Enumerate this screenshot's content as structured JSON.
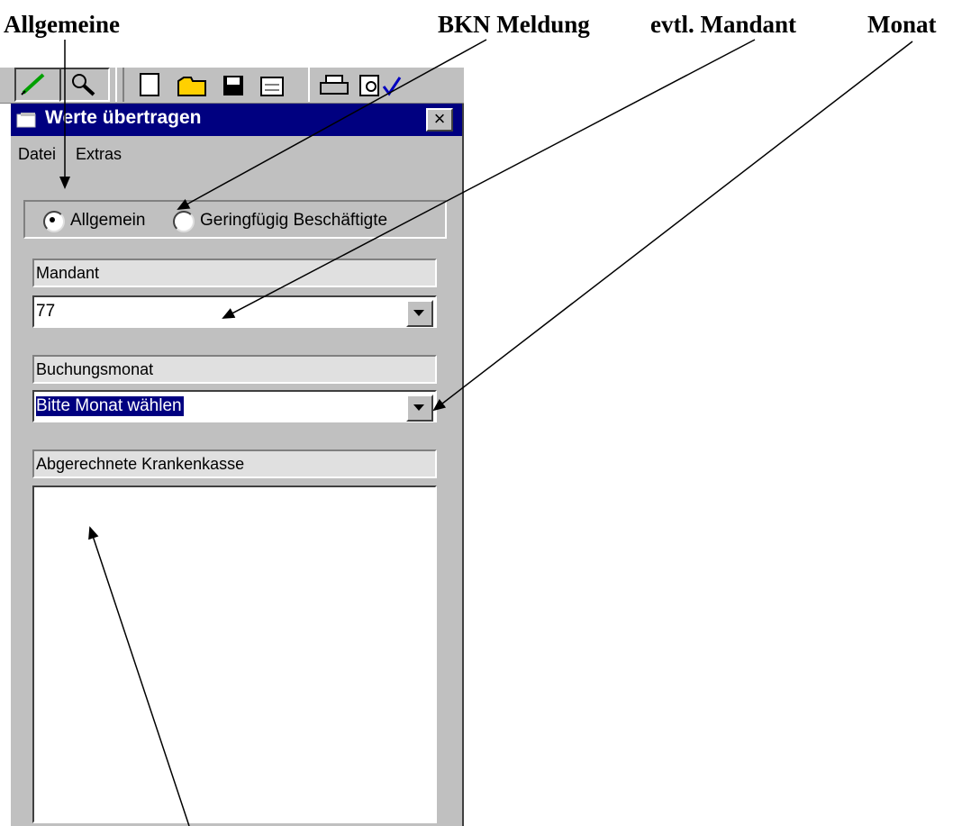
{
  "annotations": {
    "allgemeine": "Allgemeine",
    "bkn_meldung": "BKN Meldung",
    "mandant": "evtl. Mandant",
    "monat": "Monat"
  },
  "window": {
    "title": "Werte übertragen",
    "close_glyph": "×"
  },
  "menu": {
    "file": "Datei",
    "extras": "Extras"
  },
  "radio_options": {
    "general": "Allgemein",
    "marginal": "Geringfügig Beschäftigte",
    "selected": "Allgemein"
  },
  "fields": {
    "mandant_label": "Mandant",
    "mandant_value": "77",
    "month_label": "Buchungsmonat",
    "month_value": "Bitte Monat wählen",
    "kasse_label": "Abgerechnete Krankenkasse"
  },
  "colors": {
    "titlebar": "#000080",
    "selection": "#000080",
    "face": "#c0c0c0"
  }
}
